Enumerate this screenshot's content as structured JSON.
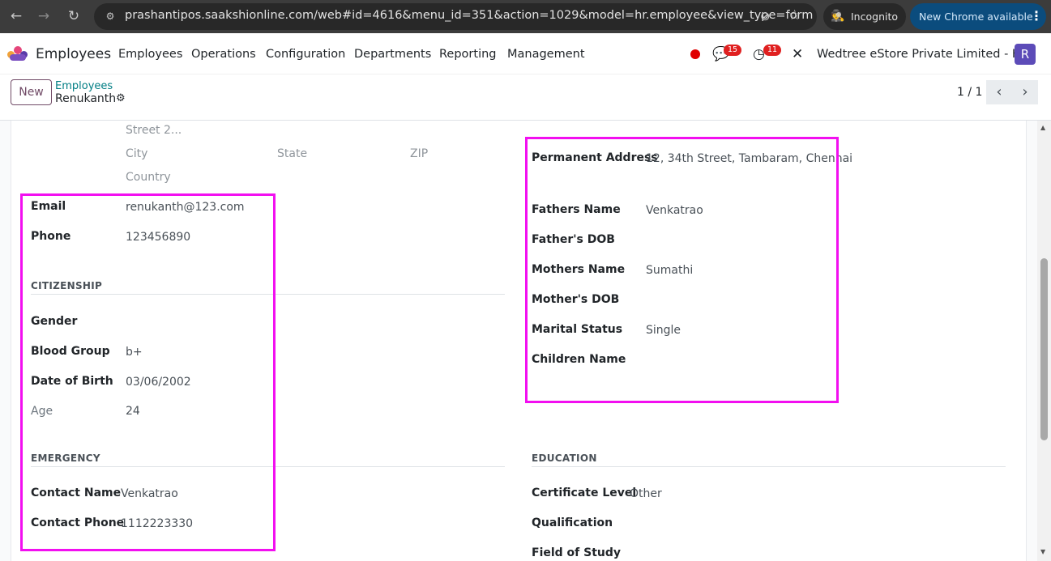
{
  "browser": {
    "url": "prashantipos.saakshionline.com/web#id=4616&menu_id=351&action=1029&model=hr.employee&view_type=form",
    "incognito_label": "Incognito",
    "update_label": "New Chrome available",
    "back_icon": "←",
    "forward_icon": "→",
    "reload_icon": "↻",
    "site_info_icon": "⚙",
    "eye_off_icon": "⊘",
    "star_icon": "☆",
    "incognito_icon": "🕵",
    "menu_dots": "⋮"
  },
  "topnav": {
    "app_name": "Employees",
    "menus": [
      "Employees",
      "Operations",
      "Configuration",
      "Departments",
      "Reporting",
      "Management"
    ],
    "chat_icon": "💬",
    "chat_count": "15",
    "activity_icon": "◷",
    "activity_count": "11",
    "tools_icon": "✕",
    "company": "Wedtree eStore Private Limited - HO",
    "avatar_letter": "R"
  },
  "control_panel": {
    "new_label": "New",
    "breadcrumb_parent": "Employees",
    "breadcrumb_current": "Renukanth",
    "gear_icon": "⚙",
    "pager": "1 / 1",
    "prev_icon": "‹",
    "next_icon": "›"
  },
  "form": {
    "address_placeholders": {
      "street2": "Street 2...",
      "city": "City",
      "state": "State",
      "zip": "ZIP",
      "country": "Country"
    },
    "contact": {
      "email_label": "Email",
      "email_value": "renukanth@123.com",
      "phone_label": "Phone",
      "phone_value": "123456890"
    },
    "citizenship": {
      "title": "CITIZENSHIP",
      "gender_label": "Gender",
      "gender_value": "",
      "blood_group_label": "Blood Group",
      "blood_group_value": "b+",
      "dob_label": "Date of Birth",
      "dob_value": "03/06/2002",
      "age_label": "Age",
      "age_value": "24"
    },
    "emergency": {
      "title": "EMERGENCY",
      "contact_name_label": "Contact Name",
      "contact_name_value": "Venkatrao",
      "contact_phone_label": "Contact Phone",
      "contact_phone_value": "1112223330"
    },
    "family": {
      "permanent_address_label": "Permanent Address",
      "permanent_address_value": "12, 34th Street, Tambaram, Chennai",
      "fathers_name_label": "Fathers Name",
      "fathers_name_value": "Venkatrao",
      "fathers_dob_label": "Father's DOB",
      "fathers_dob_value": "",
      "mothers_name_label": "Mothers Name",
      "mothers_name_value": "Sumathi",
      "mothers_dob_label": "Mother's DOB",
      "mothers_dob_value": "",
      "marital_status_label": "Marital Status",
      "marital_status_value": "Single",
      "children_name_label": "Children Name",
      "children_name_value": ""
    },
    "education": {
      "title": "EDUCATION",
      "certificate_level_label": "Certificate Level",
      "certificate_level_value": "Other",
      "qualification_label": "Qualification",
      "field_of_study_label": "Field of Study"
    }
  },
  "colors": {
    "highlight": "#f20ff0",
    "brand": "#714b67",
    "link": "#017e84"
  }
}
